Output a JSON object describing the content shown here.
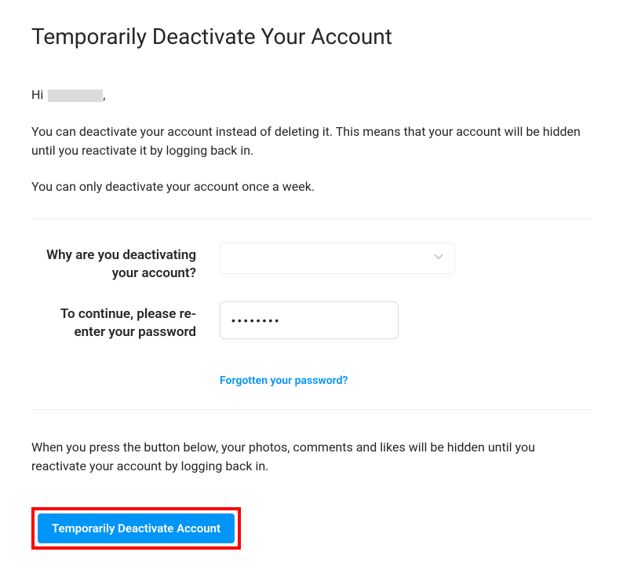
{
  "title": "Temporarily Deactivate Your Account",
  "greeting": {
    "prefix": "Hi ",
    "suffix": ","
  },
  "paragraphs": {
    "info1": "You can deactivate your account instead of deleting it. This means that your account will be hidden until you reactivate it by logging back in.",
    "info2": "You can only deactivate your account once a week.",
    "bottom": "When you press the button below, your photos, comments and likes will be hidden until you reactivate your account by logging back in."
  },
  "form": {
    "reason_label": "Why are you deactivating your account?",
    "reason_value": "",
    "password_label": "To continue, please re-enter your password",
    "password_value": "••••••••",
    "forgot_link": "Forgotten your password?"
  },
  "actions": {
    "deactivate_label": "Temporarily Deactivate Account"
  }
}
